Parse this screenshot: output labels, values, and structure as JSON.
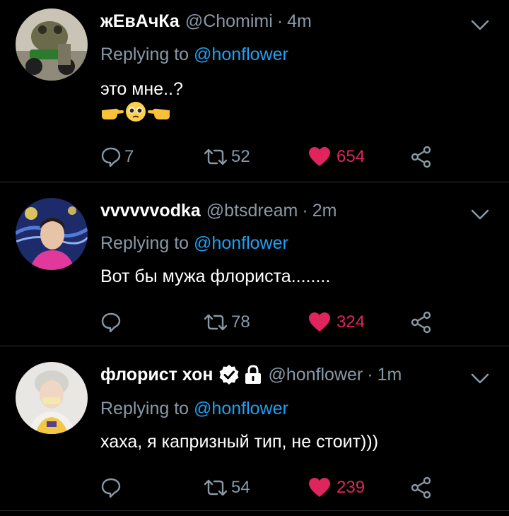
{
  "colors": {
    "background": "#000000",
    "secondary_text": "#8899a6",
    "link": "#1da1f2",
    "like": "#e0245e",
    "divider": "#2a2f33"
  },
  "tweets": [
    {
      "name": "жЕвАчКа",
      "handle": "@Chomimi",
      "dot": "·",
      "time": "4m",
      "reply_prefix": "Replying to",
      "reply_target": "@honflower",
      "text": "это мне..?",
      "emoji_icons": [
        "pointing-right-hand-icon",
        "pleading-face-icon",
        "pointing-left-hand-icon"
      ],
      "reply_count": "7",
      "retweet_count": "52",
      "like_count": "654",
      "liked": true
    },
    {
      "name": "vvvvvvodka",
      "handle": "@btsdream",
      "dot": "·",
      "time": "2m",
      "reply_prefix": "Replying to",
      "reply_target": "@honflower",
      "text": "Вот бы мужа флориста........",
      "reply_count": "",
      "retweet_count": "78",
      "like_count": "324",
      "liked": true
    },
    {
      "name": "флорист хон",
      "verified": true,
      "protected": true,
      "handle": "@honflower",
      "dot": "·",
      "time": "1m",
      "reply_prefix": "Replying to",
      "reply_target": "@honflower",
      "text": "хаха, я капризный тип, не стоит)))",
      "reply_count": "",
      "retweet_count": "54",
      "like_count": "239",
      "liked": true
    }
  ]
}
